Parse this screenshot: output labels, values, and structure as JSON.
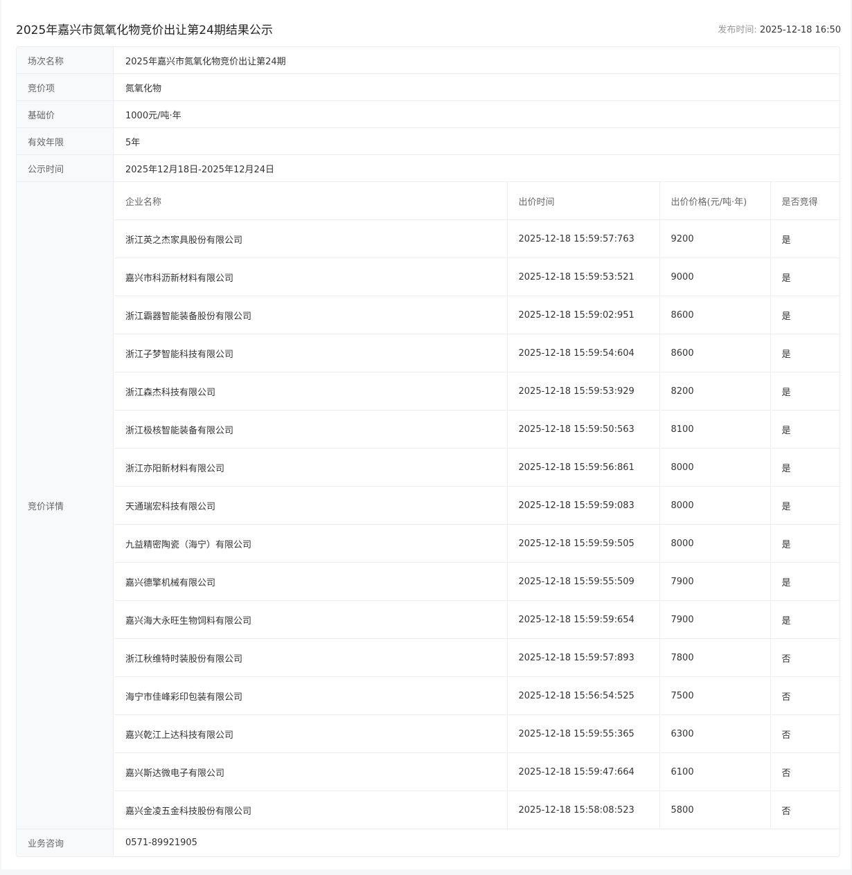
{
  "header": {
    "title": "2025年嘉兴市氮氧化物竞价出让第24期结果公示",
    "publish_label": "发布时间: ",
    "publish_time": "2025-12-18 16:50"
  },
  "info": [
    {
      "key": "场次名称",
      "value": "2025年嘉兴市氮氧化物竞价出让第24期"
    },
    {
      "key": "竞价项",
      "value": "氮氧化物"
    },
    {
      "key": "基础价",
      "value": "1000元/吨·年"
    },
    {
      "key": "有效年限",
      "value": "5年"
    },
    {
      "key": "公示时间",
      "value": "2025年12月18日-2025年12月24日"
    }
  ],
  "details": {
    "label": "竞价详情",
    "columns": [
      "企业名称",
      "出价时间",
      "出价价格(元/吨·年)",
      "是否竞得"
    ],
    "rows": [
      [
        "浙江英之杰家具股份有限公司",
        "2025-12-18 15:59:57:763",
        "9200",
        "是"
      ],
      [
        "嘉兴市科沥新材料有限公司",
        "2025-12-18 15:59:53:521",
        "9000",
        "是"
      ],
      [
        "浙江霸器智能装备股份有限公司",
        "2025-12-18 15:59:02:951",
        "8600",
        "是"
      ],
      [
        "浙江子梦智能科技有限公司",
        "2025-12-18 15:59:54:604",
        "8600",
        "是"
      ],
      [
        "浙江森杰科技有限公司",
        "2025-12-18 15:59:53:929",
        "8200",
        "是"
      ],
      [
        "浙江极核智能装备有限公司",
        "2025-12-18 15:59:50:563",
        "8100",
        "是"
      ],
      [
        "浙江亦阳新材料有限公司",
        "2025-12-18 15:59:56:861",
        "8000",
        "是"
      ],
      [
        "天通瑞宏科技有限公司",
        "2025-12-18 15:59:59:083",
        "8000",
        "是"
      ],
      [
        "九益精密陶瓷（海宁）有限公司",
        "2025-12-18 15:59:59:505",
        "8000",
        "是"
      ],
      [
        "嘉兴德擎机械有限公司",
        "2025-12-18 15:59:55:509",
        "7900",
        "是"
      ],
      [
        "嘉兴海大永旺生物饲料有限公司",
        "2025-12-18 15:59:59:654",
        "7900",
        "是"
      ],
      [
        "浙江秋维特时装股份有限公司",
        "2025-12-18 15:59:57:893",
        "7800",
        "否"
      ],
      [
        "海宁市佳峰彩印包装有限公司",
        "2025-12-18 15:56:54:525",
        "7500",
        "否"
      ],
      [
        "嘉兴乾江上达科技有限公司",
        "2025-12-18 15:59:55:365",
        "6300",
        "否"
      ],
      [
        "嘉兴斯达微电子有限公司",
        "2025-12-18 15:59:47:664",
        "6100",
        "否"
      ],
      [
        "嘉兴金凌五金科技股份有限公司",
        "2025-12-18 15:58:08:523",
        "5800",
        "否"
      ]
    ]
  },
  "contact": {
    "key": "业务咨询",
    "value": "0571-89921905"
  }
}
